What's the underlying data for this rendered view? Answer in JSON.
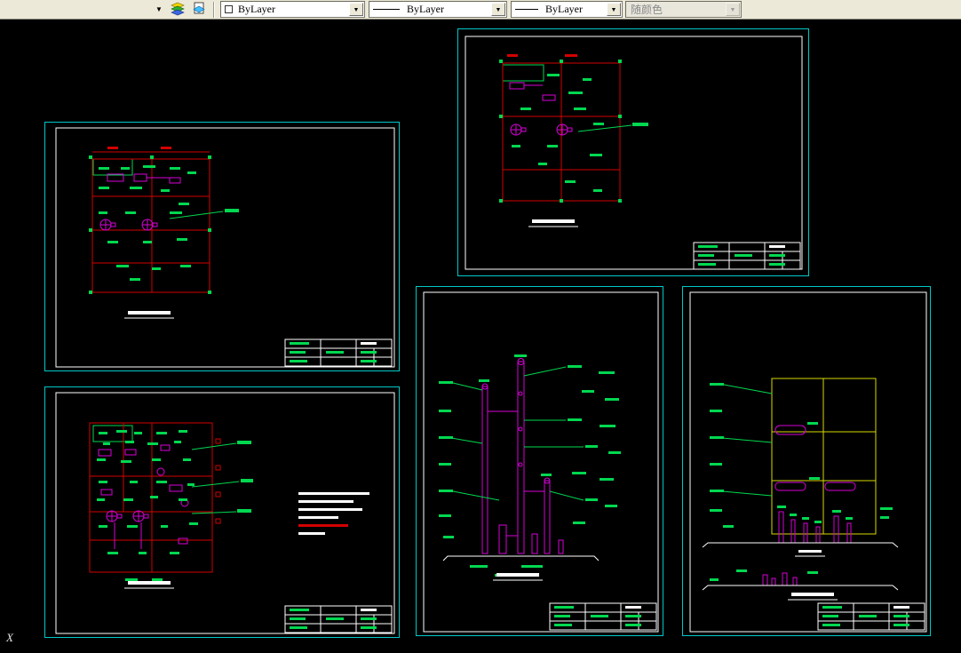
{
  "toolbar": {
    "overflow_arrow": "▼",
    "dropdown_arrow": "▼",
    "controls": {
      "color": {
        "value": "ByLayer"
      },
      "linetype": {
        "value": "ByLayer"
      },
      "lineweight": {
        "value": "ByLayer"
      },
      "plot_style": {
        "value": "随颜色"
      }
    }
  },
  "canvas": {
    "ucs_x_label": "X"
  },
  "colors": {
    "toolbar_bg": "#ece9d8",
    "canvas_bg": "#000000",
    "sheet_frame": "#00c8c8",
    "paper_white": "#ffffff",
    "axis_red": "#d40000",
    "annotation_green": "#00d850",
    "equipment_magenta": "#d800d8",
    "structure_yellow": "#d8d800"
  }
}
